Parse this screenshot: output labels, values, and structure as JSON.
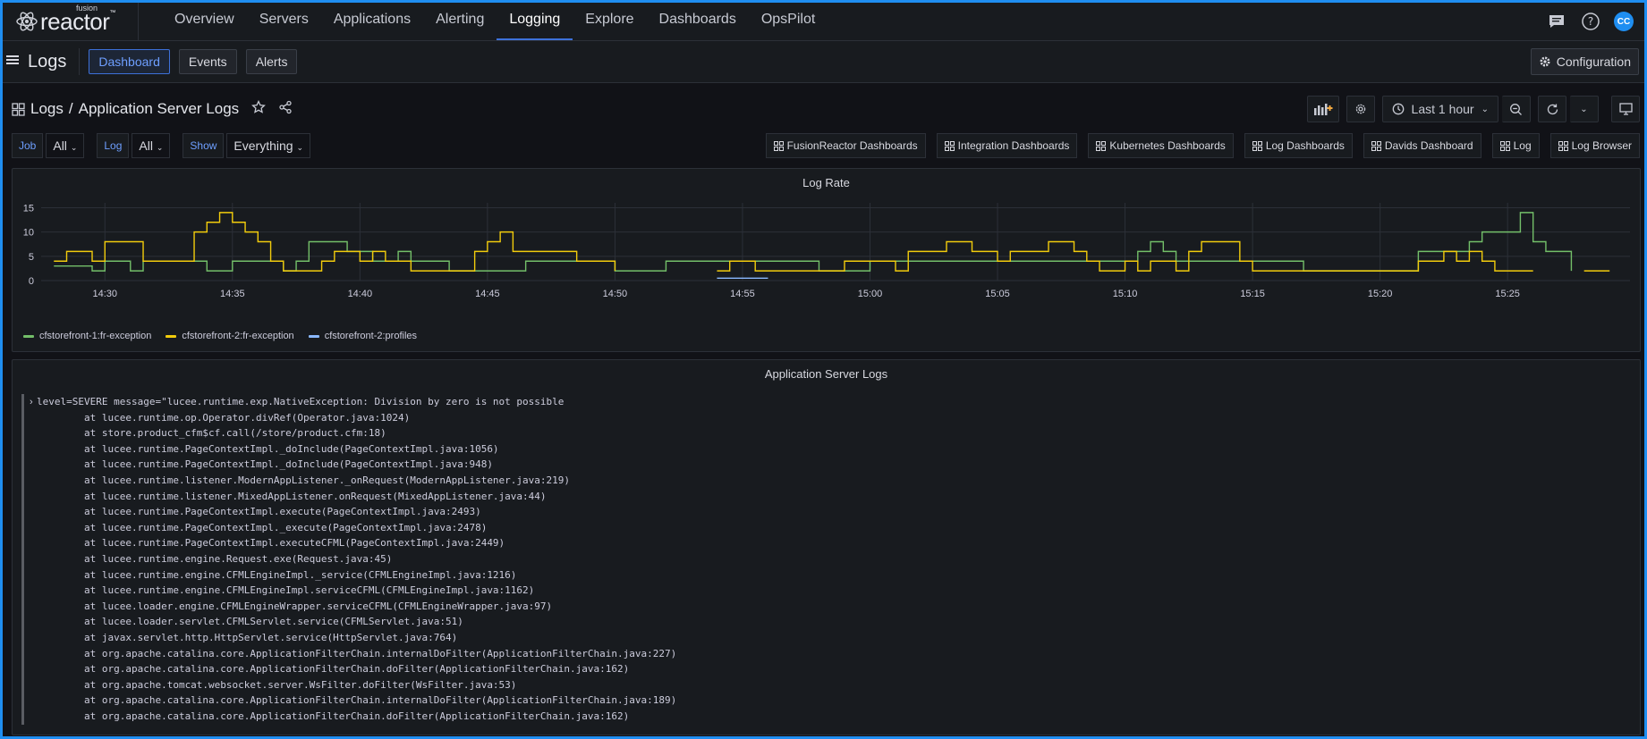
{
  "app": {
    "logo_word": "reactor",
    "logo_small": "fusion",
    "logo_tm": "™"
  },
  "nav": {
    "items": [
      "Overview",
      "Servers",
      "Applications",
      "Alerting",
      "Logging",
      "Explore",
      "Dashboards",
      "OpsPilot"
    ],
    "active": "Logging",
    "avatar_initials": "CC"
  },
  "subheader": {
    "title": "Logs",
    "tabs": [
      "Dashboard",
      "Events",
      "Alerts"
    ],
    "active_tab": "Dashboard",
    "configuration_label": "Configuration"
  },
  "dashboard": {
    "breadcrumb_root": "Logs",
    "breadcrumb_sep": "/",
    "title": "Application Server Logs",
    "time_range": "Last 1 hour"
  },
  "variables": [
    {
      "label": "Job",
      "value": "All"
    },
    {
      "label": "Log",
      "value": "All"
    },
    {
      "label": "Show",
      "value": "Everything"
    }
  ],
  "links": [
    "FusionReactor Dashboards",
    "Integration Dashboards",
    "Kubernetes Dashboards",
    "Log Dashboards",
    "Davids Dashboard",
    "Log",
    "Log Browser"
  ],
  "panels": {
    "rate_title": "Log Rate",
    "logs_title": "Application Server Logs"
  },
  "colors": {
    "series1": "#73bf69",
    "series2": "#f2cc0c",
    "series3": "#8ab8ff",
    "accent": "#3d71d9"
  },
  "chart_data": {
    "type": "line",
    "title": "Log Rate",
    "xlabel": "",
    "ylabel": "",
    "ylim": [
      0,
      16
    ],
    "x_ticks": [
      "14:30",
      "14:35",
      "14:40",
      "14:45",
      "14:50",
      "14:55",
      "15:00",
      "15:05",
      "15:10",
      "15:15",
      "15:20",
      "15:25"
    ],
    "y_ticks": [
      0,
      5,
      10,
      15
    ],
    "legend_position": "bottom-left",
    "grid": true,
    "series": [
      {
        "name": "cfstorefront-1:fr-exception",
        "color": "#73bf69",
        "points": [
          [
            "14:28",
            3
          ],
          [
            "14:29",
            3
          ],
          [
            "14:29.5",
            2
          ],
          [
            "14:30",
            4
          ],
          [
            "14:30.5",
            4
          ],
          [
            "14:31",
            2
          ],
          [
            "14:31.5",
            4
          ],
          [
            "14:32",
            4
          ],
          [
            "14:33",
            4
          ],
          [
            "14:34",
            2
          ],
          [
            "14:34.5",
            2
          ],
          [
            "14:35",
            4
          ],
          [
            "14:36",
            4
          ],
          [
            "14:37",
            2
          ],
          [
            "14:37.5",
            4
          ],
          [
            "14:38",
            8
          ],
          [
            "14:39",
            8
          ],
          [
            "14:39.5",
            6
          ],
          [
            "14:40",
            6
          ],
          [
            "14:40.5",
            4
          ],
          [
            "14:41",
            4
          ],
          [
            "14:41.5",
            6
          ],
          [
            "14:42",
            4
          ],
          [
            "14:43",
            4
          ],
          [
            "14:43.5",
            2
          ],
          [
            "14:45",
            2
          ],
          [
            "14:46",
            2
          ],
          [
            "14:46.5",
            4
          ],
          [
            "14:47",
            4
          ],
          [
            "14:48",
            4
          ],
          [
            "14:49",
            4
          ],
          [
            "14:50",
            2
          ],
          [
            "14:51",
            2
          ],
          [
            "14:52",
            2
          ],
          [
            "14:52",
            4
          ],
          [
            "14:53",
            4
          ],
          [
            "14:54",
            4
          ],
          [
            "14:55",
            4
          ],
          [
            "14:56",
            4
          ],
          [
            "14:57",
            4
          ],
          [
            "14:58",
            2
          ],
          [
            "14:59",
            2
          ],
          [
            "15:00",
            4
          ],
          [
            "15:01",
            4
          ],
          [
            "15:02",
            4
          ],
          [
            "15:03",
            4
          ],
          [
            "15:04",
            4
          ],
          [
            "15:05",
            4
          ],
          [
            "15:06",
            4
          ],
          [
            "15:07",
            4
          ],
          [
            "15:08",
            4
          ],
          [
            "15:09",
            4
          ],
          [
            "15:10",
            4
          ],
          [
            "15:10.5",
            6
          ],
          [
            "15:11",
            8
          ],
          [
            "15:11.5",
            6
          ],
          [
            "15:12",
            4
          ],
          [
            "15:13",
            4
          ],
          [
            "15:14",
            4
          ],
          [
            "15:15",
            4
          ],
          [
            "15:16",
            4
          ],
          [
            "15:17",
            2
          ],
          [
            "15:19",
            2
          ],
          [
            "15:20",
            2
          ],
          [
            "15:21",
            2
          ],
          [
            "15:21.5",
            6
          ],
          [
            "15:22",
            6
          ],
          [
            "15:23",
            6
          ],
          [
            "15:23.5",
            8
          ],
          [
            "15:24",
            10
          ],
          [
            "15:24.5",
            10
          ],
          [
            "15:25",
            10
          ],
          [
            "15:25.5",
            14
          ],
          [
            "15:26",
            8
          ],
          [
            "15:26.5",
            6
          ],
          [
            "15:27",
            6
          ],
          [
            "15:27.5",
            2
          ]
        ]
      },
      {
        "name": "cfstorefront-2:fr-exception",
        "color": "#f2cc0c",
        "points": [
          [
            "14:28",
            4
          ],
          [
            "14:28.5",
            6
          ],
          [
            "14:29",
            6
          ],
          [
            "14:29.5",
            4
          ],
          [
            "14:30",
            8
          ],
          [
            "14:31",
            8
          ],
          [
            "14:31.5",
            4
          ],
          [
            "14:32",
            4
          ],
          [
            "14:33",
            4
          ],
          [
            "14:33.5",
            10
          ],
          [
            "14:34",
            12
          ],
          [
            "14:34.5",
            14
          ],
          [
            "14:35",
            12
          ],
          [
            "14:35.5",
            10
          ],
          [
            "14:36",
            8
          ],
          [
            "14:36.5",
            4
          ],
          [
            "14:37",
            2
          ],
          [
            "14:38",
            2
          ],
          [
            "14:38.5",
            4
          ],
          [
            "14:39",
            6
          ],
          [
            "14:40",
            4
          ],
          [
            "14:40.5",
            6
          ],
          [
            "14:41",
            4
          ],
          [
            "14:42",
            2
          ],
          [
            "14:43",
            2
          ],
          [
            "14:44",
            2
          ],
          [
            "14:44.5",
            6
          ],
          [
            "14:45",
            8
          ],
          [
            "14:45.5",
            10
          ],
          [
            "14:46",
            6
          ],
          [
            "14:47",
            6
          ],
          [
            "14:48",
            6
          ],
          [
            "14:48.5",
            4
          ],
          [
            "14:49",
            4
          ],
          [
            "14:50",
            2
          ],
          [
            "14:52",
            null
          ],
          [
            "14:54",
            2
          ],
          [
            "14:54.5",
            4
          ],
          [
            "14:55",
            4
          ],
          [
            "14:55.5",
            2
          ],
          [
            "14:57",
            2
          ],
          [
            "14:58",
            2
          ],
          [
            "14:59",
            4
          ],
          [
            "15:00",
            4
          ],
          [
            "15:01",
            2
          ],
          [
            "15:01.5",
            6
          ],
          [
            "15:02",
            6
          ],
          [
            "15:03",
            8
          ],
          [
            "15:04",
            6
          ],
          [
            "15:05",
            4
          ],
          [
            "15:05.5",
            6
          ],
          [
            "15:06",
            6
          ],
          [
            "15:07",
            8
          ],
          [
            "15:08",
            6
          ],
          [
            "15:08.5",
            4
          ],
          [
            "15:09",
            2
          ],
          [
            "15:10",
            4
          ],
          [
            "15:10.5",
            2
          ],
          [
            "15:11",
            4
          ],
          [
            "15:12",
            2
          ],
          [
            "15:12.5",
            6
          ],
          [
            "15:13",
            8
          ],
          [
            "15:14",
            8
          ],
          [
            "15:14.5",
            4
          ],
          [
            "15:15",
            2
          ],
          [
            "15:16",
            2
          ],
          [
            "15:20",
            2
          ],
          [
            "15:21",
            2
          ],
          [
            "15:21.5",
            4
          ],
          [
            "15:22",
            4
          ],
          [
            "15:22.5",
            6
          ],
          [
            "15:23",
            4
          ],
          [
            "15:23.5",
            6
          ],
          [
            "15:24",
            4
          ],
          [
            "15:24.5",
            2
          ],
          [
            "15:25",
            2
          ],
          [
            "15:26",
            2
          ],
          [
            "15:27",
            null
          ],
          [
            "15:28",
            2
          ],
          [
            "15:29",
            2
          ]
        ]
      },
      {
        "name": "cfstorefront-2:profiles",
        "color": "#8ab8ff",
        "points": [
          [
            "14:54",
            0.5
          ],
          [
            "14:56",
            0.5
          ]
        ]
      }
    ]
  },
  "log_lines": [
    "level=SEVERE message=\"lucee.runtime.exp.NativeException: Division by zero is not possible",
    "        at lucee.runtime.op.Operator.divRef(Operator.java:1024)",
    "        at store.product_cfm$cf.call(/store/product.cfm:18)",
    "        at lucee.runtime.PageContextImpl._doInclude(PageContextImpl.java:1056)",
    "        at lucee.runtime.PageContextImpl._doInclude(PageContextImpl.java:948)",
    "        at lucee.runtime.listener.ModernAppListener._onRequest(ModernAppListener.java:219)",
    "        at lucee.runtime.listener.MixedAppListener.onRequest(MixedAppListener.java:44)",
    "        at lucee.runtime.PageContextImpl.execute(PageContextImpl.java:2493)",
    "        at lucee.runtime.PageContextImpl._execute(PageContextImpl.java:2478)",
    "        at lucee.runtime.PageContextImpl.executeCFML(PageContextImpl.java:2449)",
    "        at lucee.runtime.engine.Request.exe(Request.java:45)",
    "        at lucee.runtime.engine.CFMLEngineImpl._service(CFMLEngineImpl.java:1216)",
    "        at lucee.runtime.engine.CFMLEngineImpl.serviceCFML(CFMLEngineImpl.java:1162)",
    "        at lucee.loader.engine.CFMLEngineWrapper.serviceCFML(CFMLEngineWrapper.java:97)",
    "        at lucee.loader.servlet.CFMLServlet.service(CFMLServlet.java:51)",
    "        at javax.servlet.http.HttpServlet.service(HttpServlet.java:764)",
    "        at org.apache.catalina.core.ApplicationFilterChain.internalDoFilter(ApplicationFilterChain.java:227)",
    "        at org.apache.catalina.core.ApplicationFilterChain.doFilter(ApplicationFilterChain.java:162)",
    "        at org.apache.tomcat.websocket.server.WsFilter.doFilter(WsFilter.java:53)",
    "        at org.apache.catalina.core.ApplicationFilterChain.internalDoFilter(ApplicationFilterChain.java:189)",
    "        at org.apache.catalina.core.ApplicationFilterChain.doFilter(ApplicationFilterChain.java:162)"
  ]
}
